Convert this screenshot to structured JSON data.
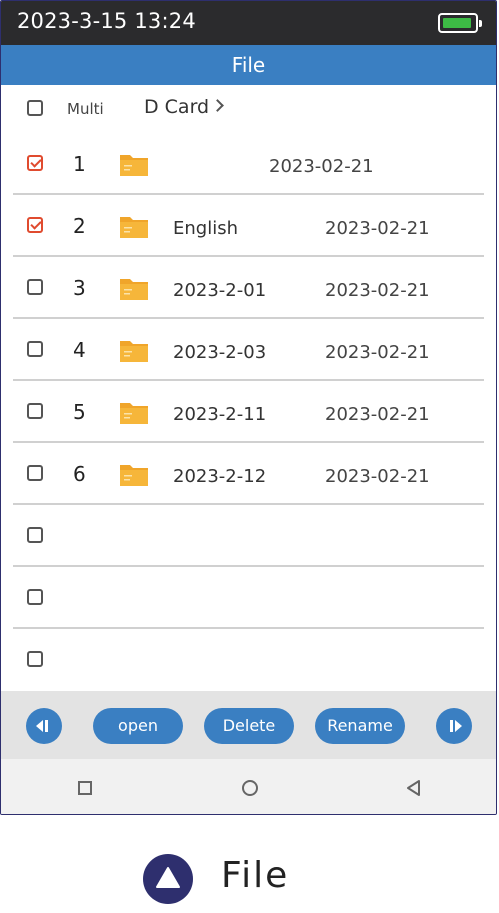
{
  "status_bar": {
    "time": "2023-3-15 13:24",
    "battery_icon": "battery-icon",
    "battery_color": "#3dbb45"
  },
  "title": "File",
  "header": {
    "multi_label": "Multi",
    "path": "D Card"
  },
  "rows": [
    {
      "checked": true,
      "num": "1",
      "name": "",
      "date": "2023-02-21"
    },
    {
      "checked": true,
      "num": "2",
      "name": "English",
      "date": "2023-02-21"
    },
    {
      "checked": false,
      "num": "3",
      "name": "2023-2-01",
      "date": "2023-02-21"
    },
    {
      "checked": false,
      "num": "4",
      "name": "2023-2-03",
      "date": "2023-02-21"
    },
    {
      "checked": false,
      "num": "5",
      "name": "2023-2-11",
      "date": "2023-02-21"
    },
    {
      "checked": false,
      "num": "6",
      "name": "2023-2-12",
      "date": "2023-02-21"
    },
    {
      "checked": false,
      "num": "",
      "name": "",
      "date": ""
    },
    {
      "checked": false,
      "num": "",
      "name": "",
      "date": ""
    },
    {
      "checked": false,
      "num": "",
      "name": "",
      "date": ""
    }
  ],
  "toolbar": {
    "open_label": "open",
    "delete_label": "Delete",
    "rename_label": "Rename"
  },
  "caption": {
    "label": "File"
  },
  "colors": {
    "accent": "#3a7fc2",
    "status_bar": "#2b2b2d",
    "check": "#e04b2f",
    "folder": "#f6b63a",
    "caption_circle": "#2e2f6e"
  }
}
